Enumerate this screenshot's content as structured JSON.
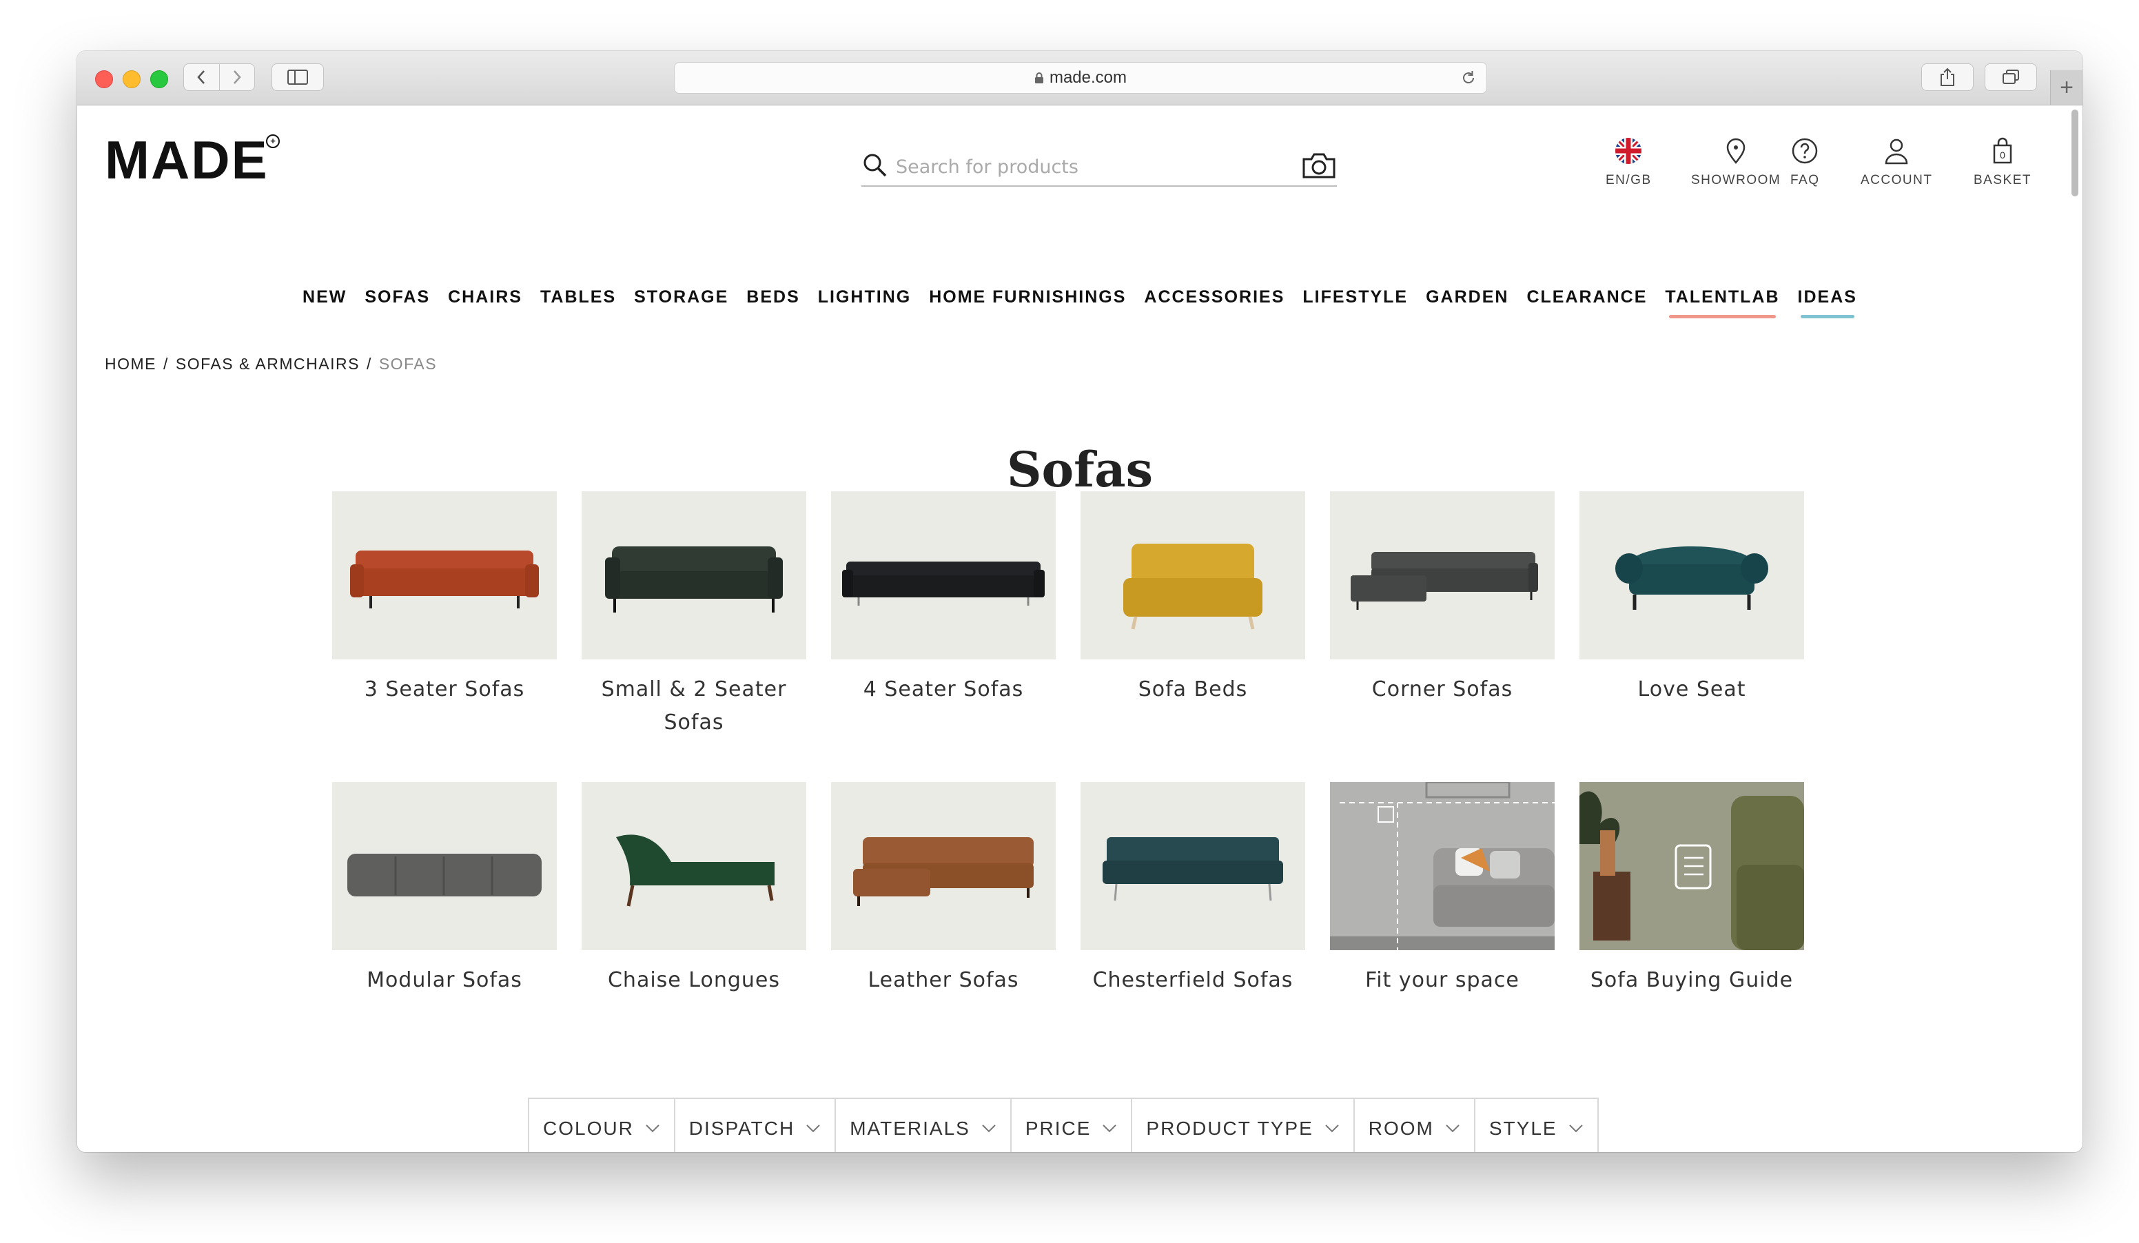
{
  "browser": {
    "url": "made.com"
  },
  "header": {
    "logo": "MADE",
    "search_placeholder": "Search for products",
    "utilities": [
      {
        "label": "EN/GB",
        "icon": "uk-flag-icon"
      },
      {
        "label": "SHOWROOM",
        "icon": "location-pin-icon"
      },
      {
        "label": "FAQ",
        "icon": "question-circle-icon"
      },
      {
        "label": "ACCOUNT",
        "icon": "user-icon"
      },
      {
        "label": "BASKET",
        "icon": "basket-icon",
        "count": "0"
      }
    ]
  },
  "nav": {
    "items": [
      "NEW",
      "SOFAS",
      "CHAIRS",
      "TABLES",
      "STORAGE",
      "BEDS",
      "LIGHTING",
      "HOME FURNISHINGS",
      "ACCESSORIES",
      "LIFESTYLE",
      "GARDEN",
      "CLEARANCE",
      "TALENTLAB",
      "IDEAS"
    ],
    "accents": {
      "TALENTLAB": "#f0968a",
      "IDEAS": "#7fc3d3"
    }
  },
  "breadcrumb": {
    "items": [
      "HOME",
      "SOFAS & ARMCHAIRS",
      "SOFAS"
    ]
  },
  "page": {
    "title": "Sofas"
  },
  "categories": [
    {
      "label": "3 Seater Sofas",
      "color": "#b8492a"
    },
    {
      "label": "Small & 2 Seater Sofas",
      "color": "#2f3b33"
    },
    {
      "label": "4 Seater Sofas",
      "color": "#222326"
    },
    {
      "label": "Sofa Beds",
      "color": "#d6a82e"
    },
    {
      "label": "Corner Sofas",
      "color": "#4b4d4c"
    },
    {
      "label": "Love Seat",
      "color": "#1f5357"
    },
    {
      "label": "Modular Sofas",
      "color": "#5f605e"
    },
    {
      "label": "Chaise Longues",
      "color": "#1f4a30"
    },
    {
      "label": "Leather Sofas",
      "color": "#9a5b34"
    },
    {
      "label": "Chesterfield Sofas",
      "color": "#264a50"
    },
    {
      "label": "Fit your space",
      "color": "#b3b3b1"
    },
    {
      "label": "Sofa Buying Guide",
      "color": "#6b6f46"
    }
  ],
  "filters": [
    "COLOUR",
    "DISPATCH",
    "MATERIALS",
    "PRICE",
    "PRODUCT TYPE",
    "ROOM",
    "STYLE"
  ]
}
